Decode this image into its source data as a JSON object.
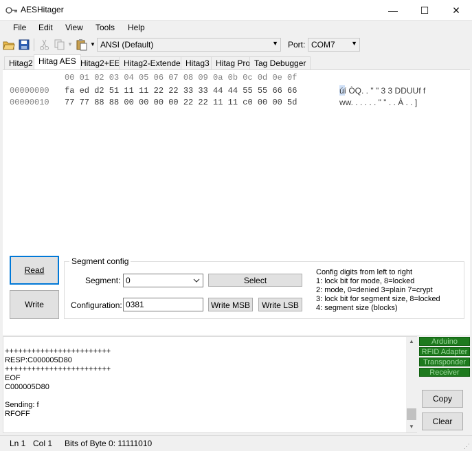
{
  "window": {
    "title": "AESHitager",
    "minimize_glyph": "—",
    "maximize_glyph": "☐",
    "close_glyph": "✕"
  },
  "menu": {
    "file": "File",
    "edit": "Edit",
    "view": "View",
    "tools": "Tools",
    "help": "Help"
  },
  "toolbar": {
    "encoding": "ANSI (Default)",
    "port_label": "Port:",
    "port_value": "COM7",
    "icons": [
      "open-folder-icon",
      "save-icon",
      "cut-icon",
      "copy-icon",
      "paste-icon"
    ]
  },
  "tabs": [
    "Hitag2",
    "Hitag AES",
    "Hitag2+EE",
    "Hitag2-Extended",
    "Hitag3",
    "Hitag Pro",
    "Tag Debugger"
  ],
  "active_tab": "Hitag AES",
  "hex": {
    "header": "00 01 02 03 04 05 06 07 08 09 0a 0b 0c 0d 0e 0f",
    "rows": [
      {
        "offset": "00000000",
        "bytes": "fa ed d2 51 11 11 22 22 33 33 44 44 55 55 66 66",
        "ascii": "úí ÒQ. . \" \" 3 3 DDUUf f"
      },
      {
        "offset": "00000010",
        "bytes": "77 77 88 88 00 00 00 00 22 22 11 11 c0 00 00 5d",
        "ascii": "ww. . . . . . \" \" . . À . . ]"
      }
    ]
  },
  "controls": {
    "read_label": "Read",
    "write_label": "Write",
    "segment_config_title": "Segment config",
    "segment_label": "Segment:",
    "segment_value": "0",
    "select_label": "Select",
    "configuration_label": "Configuration:",
    "configuration_value": "0381",
    "write_msb_label": "Write MSB",
    "write_lsb_label": "Write LSB",
    "help_lines": [
      "Config digits from left to right",
      "1: lock bit for mode, 8=locked",
      "2: mode, 0=denied 3=plain 7=crypt",
      "3: lock bit for segment size, 8=locked",
      "4: segment size (blocks)"
    ]
  },
  "log": {
    "lines": "++++++++++++++++++++++++\nRESP:C000005D80\n++++++++++++++++++++++++\nEOF\nC000005D80\n\nSending: f\nRFOFF"
  },
  "status_indicators": [
    "Arduino",
    "RFID Adapter",
    "Transponder",
    "Receiver"
  ],
  "side_buttons": {
    "copy_label": "Copy",
    "clear_label": "Clear"
  },
  "statusbar": {
    "line": "Ln 1",
    "col": "Col 1",
    "bits": "Bits of Byte 0: 11111010"
  },
  "colors": {
    "indicator_green": "#1e7a1e",
    "focus_blue": "#0078d7"
  }
}
